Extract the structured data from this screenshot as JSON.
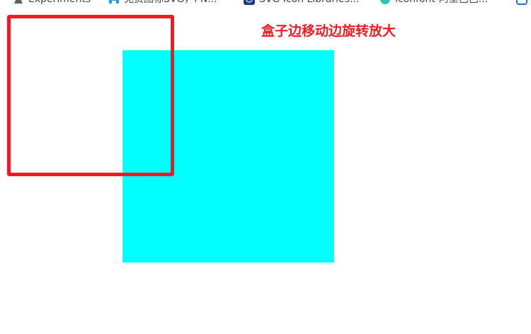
{
  "bookmarks": [
    {
      "label": "Experiments",
      "icon": "experiments-flask-icon"
    },
    {
      "label": "免费图标SVG，PN...",
      "icon": "free-icons-site-icon"
    },
    {
      "label": "SVG Icon Libraries...",
      "icon": "svg-icon-libraries-icon"
    },
    {
      "label": "iconfont-阿里巴巴...",
      "icon": "iconfont-icon"
    },
    {
      "label": "",
      "icon": "bookmark-overflow-icon"
    }
  ],
  "demo": {
    "caption": "盒子边移动边旋转放大"
  },
  "colors": {
    "cyan_box": "#00ffff",
    "red_outline": "#ed1c24",
    "caption_text": "#ed1c24",
    "page_background": "#ffffff"
  }
}
